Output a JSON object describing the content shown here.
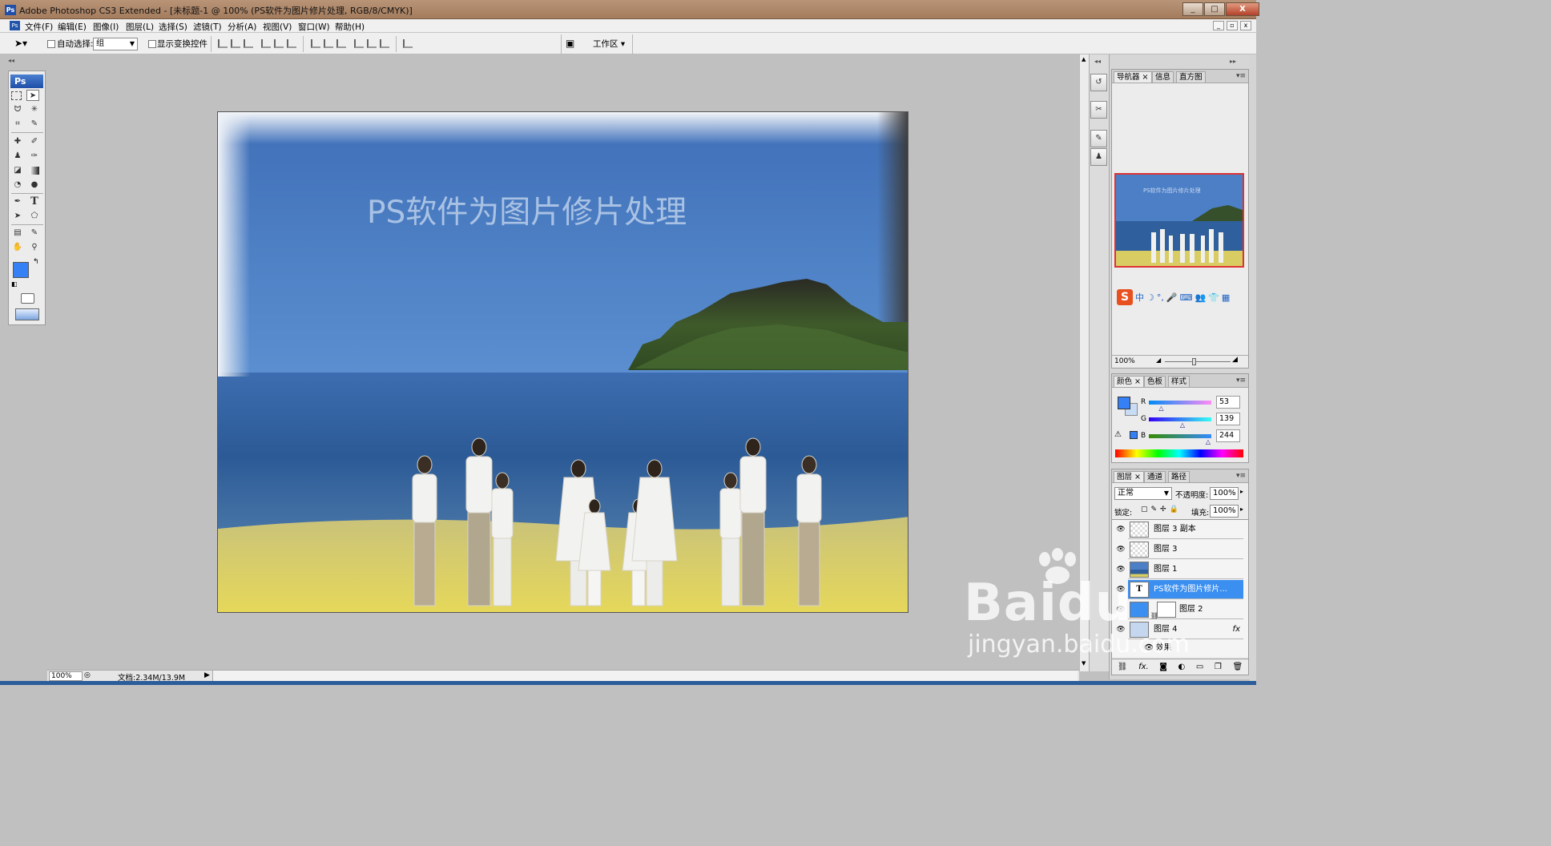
{
  "titlebar": {
    "app_icon": "Ps",
    "title": "Adobe Photoshop CS3 Extended - [未标题-1 @ 100% (PS软件为图片修片处理, RGB/8/CMYK)]",
    "minimize": "_",
    "maximize": "□",
    "close": "X"
  },
  "menubar": {
    "items": [
      "文件(F)",
      "编辑(E)",
      "图像(I)",
      "图层(L)",
      "选择(S)",
      "滤镜(T)",
      "分析(A)",
      "视图(V)",
      "窗口(W)",
      "帮助(H)"
    ],
    "doc_min": "_",
    "doc_restore": "▫",
    "doc_close": "x"
  },
  "options": {
    "auto_select_label": "自动选择:",
    "auto_select_value": "组",
    "show_transform_label": "显示变换控件",
    "workspace_label": "工作区 ▾"
  },
  "toolbox": {
    "header": "Ps",
    "foreground_color": "#3580f4",
    "background_color": "#c9dcf5"
  },
  "canvas": {
    "text_layer": "PS软件为图片修片处理"
  },
  "statusbar": {
    "zoom": "100%",
    "doc_size": "文档:2.34M/13.9M"
  },
  "navigator": {
    "tabs": [
      "导航器",
      "信息",
      "直方图"
    ],
    "zoom": "100%",
    "thumb_text": "PS软件为图片修片处理"
  },
  "ime": {
    "items": [
      "中",
      "☽",
      "°,",
      "🎤",
      "⌨",
      "👥",
      "👕",
      "▦"
    ]
  },
  "color_panel": {
    "tabs": [
      "颜色",
      "色板",
      "样式"
    ],
    "channels": [
      {
        "label": "R",
        "value": "53",
        "fraction": 0.21
      },
      {
        "label": "G",
        "value": "139",
        "fraction": 0.55
      },
      {
        "label": "B",
        "value": "244",
        "fraction": 0.96
      }
    ]
  },
  "layers_panel": {
    "tabs": [
      "图层",
      "通道",
      "路径"
    ],
    "blend_mode": "正常",
    "opacity_label": "不透明度:",
    "opacity_value": "100%",
    "lock_label": "锁定:",
    "fill_label": "填充:",
    "fill_value": "100%",
    "layers": [
      {
        "name": "图层 3 副本"
      },
      {
        "name": "图层 3"
      },
      {
        "name": "图层 1"
      },
      {
        "name": "PS软件为图片修片..."
      },
      {
        "name": "图层 2"
      },
      {
        "name": "图层 4"
      }
    ],
    "effects_label": "效果",
    "fx_label": "fx"
  },
  "watermark": {
    "line1": "Baidu",
    "line2": "jingyan.baidu.com"
  }
}
